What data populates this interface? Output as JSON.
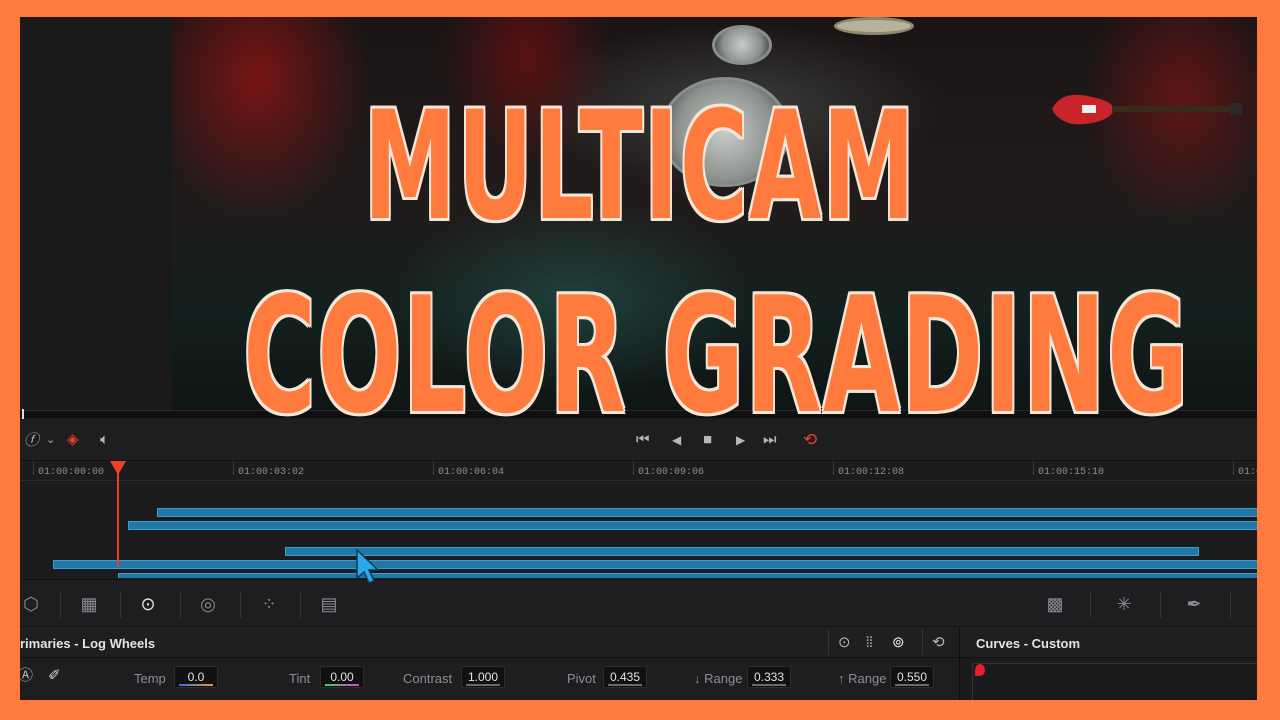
{
  "headline": {
    "line1": "MULTICAM",
    "line2": "COLOR GRADING",
    "color": "#ff7a3d"
  },
  "viewer": {
    "description_icon": "video-frame"
  },
  "transport": {
    "left_icons": [
      "fx-icon",
      "chevron-down-icon",
      "layers-icon",
      "speaker-icon"
    ],
    "controls": [
      "skip-to-start-icon",
      "play-reverse-icon",
      "stop-icon",
      "play-icon",
      "skip-to-end-icon",
      "loop-icon"
    ]
  },
  "timeline": {
    "timecodes": [
      "01:00:00:00",
      "01:00:03:02",
      "01:00:06:04",
      "01:00:09:06",
      "01:00:12:08",
      "01:00:15:10",
      "01:0"
    ],
    "playhead_color": "#e8402a",
    "clip_color": "#1f78a8"
  },
  "palette_toolbar": {
    "left_icons": [
      "3d-cube-icon",
      "grid-icon",
      "color-wheels-icon",
      "hdr-icon",
      "rgb-mixer-icon",
      "motion-effects-icon"
    ],
    "right_icons": [
      "curves-icon",
      "warper-icon",
      "qualifier-icon"
    ]
  },
  "primaries": {
    "title": "rimaries - Log Wheels",
    "params": [
      {
        "label": "Temp",
        "value": "0.0"
      },
      {
        "label": "Tint",
        "value": "0.00"
      },
      {
        "label": "Contrast",
        "value": "1.000"
      },
      {
        "label": "Pivot",
        "value": "0.435"
      },
      {
        "label": "↓ Range",
        "value": "0.333"
      },
      {
        "label": "↑ Range",
        "value": "0.550"
      }
    ]
  },
  "curves": {
    "title": "Curves - Custom"
  }
}
